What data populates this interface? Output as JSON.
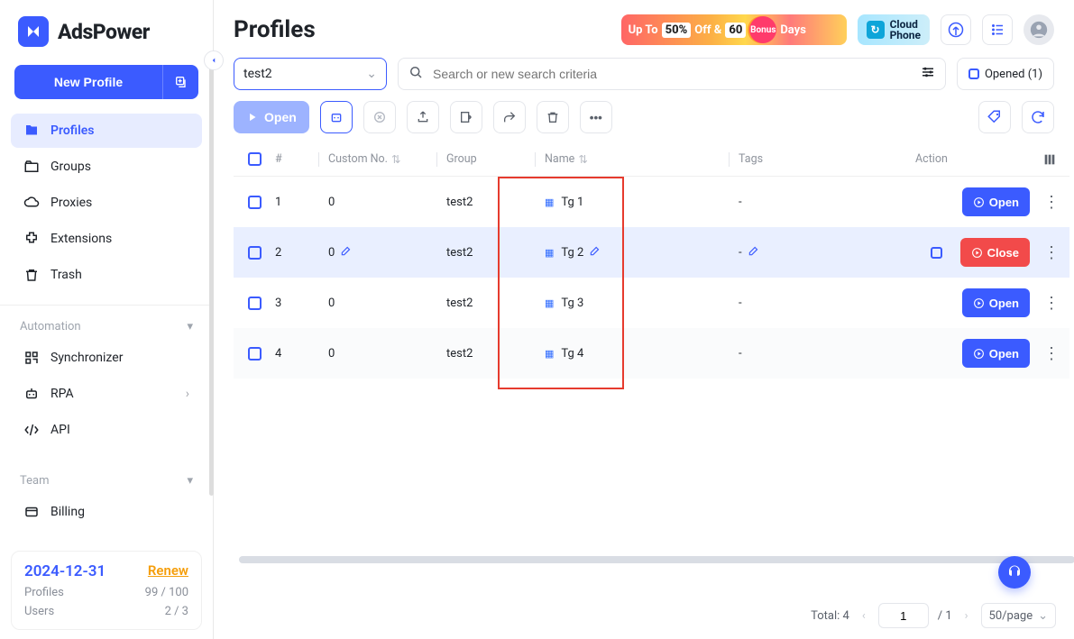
{
  "brand": {
    "name": "AdsPower"
  },
  "sidebar": {
    "new_profile": "New Profile",
    "items": [
      {
        "label": "Profiles"
      },
      {
        "label": "Groups"
      },
      {
        "label": "Proxies"
      },
      {
        "label": "Extensions"
      },
      {
        "label": "Trash"
      }
    ],
    "automation_title": "Automation",
    "automation": [
      {
        "label": "Synchronizer"
      },
      {
        "label": "RPA"
      },
      {
        "label": "API"
      }
    ],
    "team_title": "Team",
    "team": [
      {
        "label": "Billing"
      }
    ]
  },
  "footer": {
    "date": "2024-12-31",
    "renew": "Renew",
    "profiles_label": "Profiles",
    "profiles_value": "99 / 100",
    "users_label": "Users",
    "users_value": "2 / 3"
  },
  "page": {
    "title": "Profiles"
  },
  "promo1": {
    "up_to": "Up To",
    "pct": "50%",
    "off_amp": "Off &",
    "sixty": "60",
    "bonus": "Bonus",
    "days": "Days"
  },
  "promo2": {
    "line1": "Cloud",
    "line2": "Phone"
  },
  "filters": {
    "group_value": "test2",
    "search_placeholder": "Search or new search criteria",
    "opened_label": "Opened (1)"
  },
  "actionbar": {
    "open": "Open"
  },
  "table": {
    "headers": {
      "idx": "#",
      "custom": "Custom No.",
      "group": "Group",
      "name": "Name",
      "tags": "Tags",
      "action": "Action"
    },
    "rows": [
      {
        "idx": "1",
        "custom": "0",
        "group": "test2",
        "name": "Tg 1",
        "tags": "-",
        "action": "open",
        "action_label": "Open",
        "selected": false,
        "editable": false
      },
      {
        "idx": "2",
        "custom": "0",
        "group": "test2",
        "name": "Tg 2",
        "tags": "-",
        "action": "close",
        "action_label": "Close",
        "selected": true,
        "editable": true
      },
      {
        "idx": "3",
        "custom": "0",
        "group": "test2",
        "name": "Tg 3",
        "tags": "-",
        "action": "open",
        "action_label": "Open",
        "selected": false,
        "editable": false
      },
      {
        "idx": "4",
        "custom": "0",
        "group": "test2",
        "name": "Tg 4",
        "tags": "-",
        "action": "open",
        "action_label": "Open",
        "selected": false,
        "editable": false
      }
    ]
  },
  "pager": {
    "total_label": "Total: 4",
    "page_value": "1",
    "page_total": "/ 1",
    "per_page": "50/page"
  }
}
